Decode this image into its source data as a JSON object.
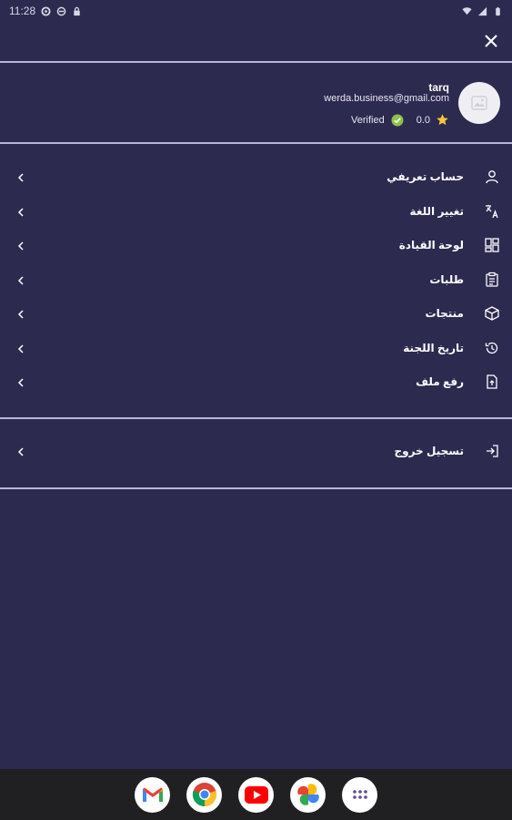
{
  "status_bar": {
    "time": "11:28",
    "left_icons": [
      "settings-icon",
      "block-icon",
      "lock-icon"
    ],
    "right_icons": [
      "wifi-icon",
      "signal-icon",
      "battery-icon"
    ]
  },
  "header": {
    "close_icon": "close-icon"
  },
  "profile": {
    "name": "tarq",
    "email": "werda.business@gmail.com",
    "verified_label": "Verified",
    "rating": "0.0",
    "accent_star": "#f3c83a",
    "accent_verified": "#8bc34a"
  },
  "menu": {
    "items": [
      {
        "label": "حساب تعريفي",
        "icon": "user-icon"
      },
      {
        "label": "تغيير اللغة",
        "icon": "translate-icon"
      },
      {
        "label": "لوحة القيادة",
        "icon": "dashboard-icon"
      },
      {
        "label": "طلبات",
        "icon": "orders-icon"
      },
      {
        "label": "منتجات",
        "icon": "box-icon"
      },
      {
        "label": "تاريخ اللجنة",
        "icon": "history-icon"
      },
      {
        "label": "رفع ملف",
        "icon": "file-upload-icon"
      }
    ],
    "logout_label": "تسجيل خروج"
  },
  "dock": {
    "apps": [
      "Gmail",
      "Chrome",
      "YouTube",
      "Photos",
      "App drawer"
    ]
  },
  "colors": {
    "background": "#2d2a50",
    "divider": "#b9b6d6",
    "nav_bar": "#202022"
  }
}
